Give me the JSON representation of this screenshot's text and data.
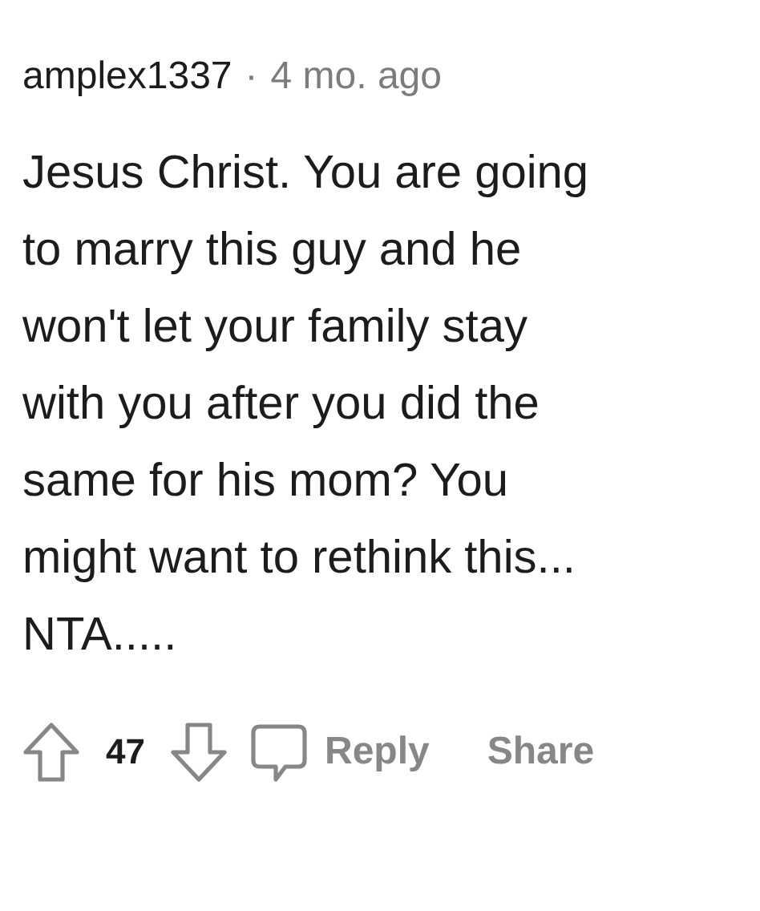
{
  "comment": {
    "author": "amplex1337",
    "separator": "·",
    "age": "4 mo. ago",
    "body": "Jesus Christ. You are going\nto marry this guy and he\nwon't let your family stay\nwith you after you did the\nsame for his mom? You\nmight want to rethink this...\nNTA.....",
    "score": "47",
    "actions": [
      "Reply",
      "Share"
    ]
  }
}
